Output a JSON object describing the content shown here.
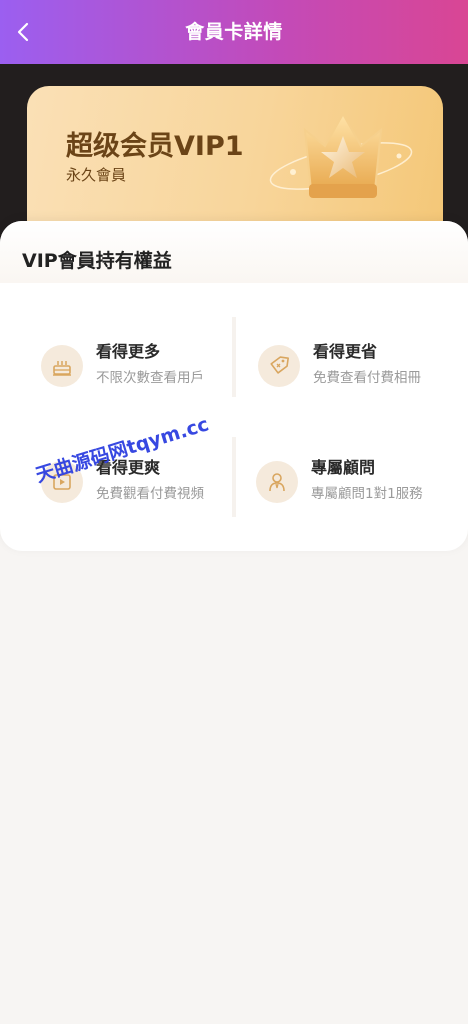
{
  "header": {
    "title": "會員卡詳情",
    "back_icon": "chevron-left-icon"
  },
  "vip_card": {
    "level_title": "超级会员VIP1",
    "duration": "永久會員",
    "icon": "crown-star-icon"
  },
  "benefits_panel": {
    "title": "VIP會員持有權益",
    "items": [
      {
        "title": "看得更多",
        "desc": "不限次數查看用戶",
        "icon": "cake-icon"
      },
      {
        "title": "看得更省",
        "desc": "免費查看付費相冊",
        "icon": "tag-icon"
      },
      {
        "title": "看得更爽",
        "desc": "免費觀看付費視頻",
        "icon": "video-icon"
      },
      {
        "title": "專屬顧問",
        "desc": "專屬顧問1對1服務",
        "icon": "advisor-icon"
      }
    ]
  },
  "watermark": {
    "text": "天曲源码网tqym.cc"
  },
  "colors": {
    "header_gradient_start": "#9b5ff0",
    "header_gradient_end": "#d94694",
    "card_gold": "#f8d59a",
    "card_text": "#6b4417",
    "icon_gold": "#d9a65f"
  }
}
